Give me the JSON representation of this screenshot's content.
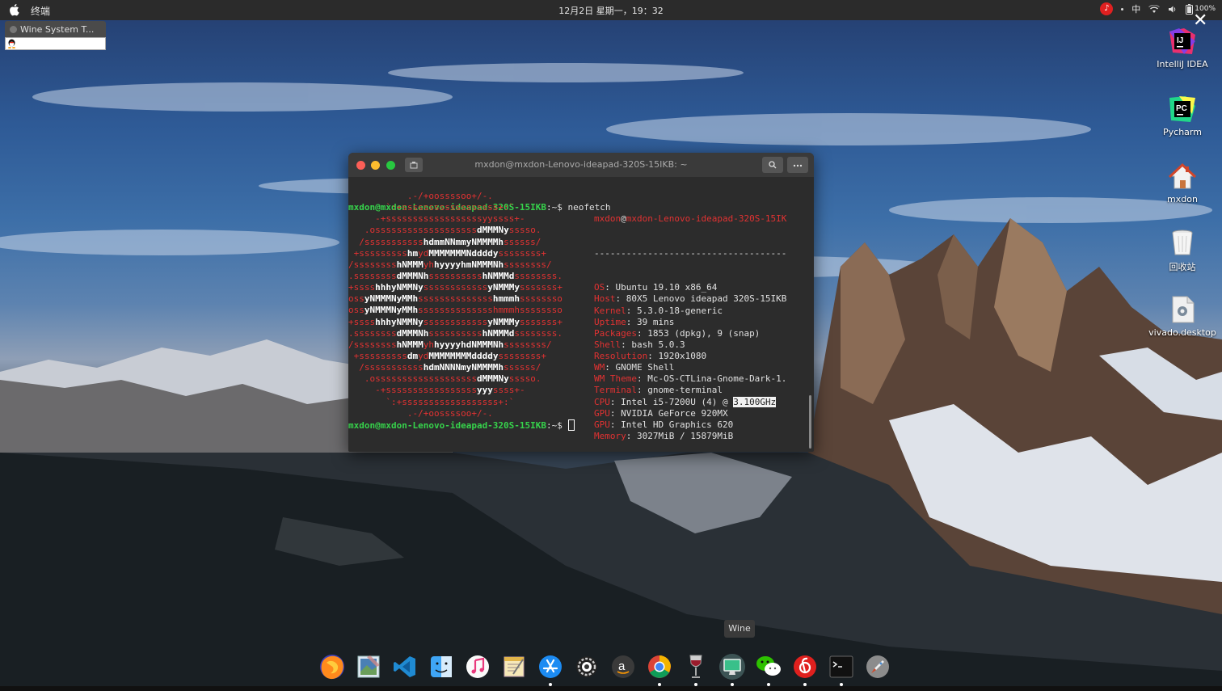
{
  "topbar": {
    "app_name": "终端",
    "clock": "12月2日 星期一，19：32",
    "input_method": "中",
    "battery": "100%",
    "netease_glyph": "♪"
  },
  "wine_window": {
    "title": "Wine System T..."
  },
  "desktop_icons": [
    {
      "label": "IntelliJ IDEA",
      "icon": "intellij-icon"
    },
    {
      "label": "Pycharm",
      "icon": "pycharm-icon"
    },
    {
      "label": "mxdon",
      "icon": "home-folder-icon"
    },
    {
      "label": "回收站",
      "icon": "trash-icon"
    },
    {
      "label": "vivado.desktop",
      "icon": "desktop-file-icon"
    }
  ],
  "terminal": {
    "title": "mxdon@mxdon-Lenovo-ideapad-320S-15IKB: ~",
    "prompt_user": "mxdon@mxdon-Lenovo-ideapad-320S-15IKB",
    "prompt_suffix": ":~$ ",
    "command": "neofetch",
    "header_user": "mxdon",
    "header_at": "@",
    "header_host": "mxdon-Lenovo-ideapad-320S-15IK",
    "separator": "------------------------------------",
    "info": [
      {
        "key": "OS",
        "value": "Ubuntu 19.10 x86_64"
      },
      {
        "key": "Host",
        "value": "80X5 Lenovo ideapad 320S-15IKB"
      },
      {
        "key": "Kernel",
        "value": "5.3.0-18-generic"
      },
      {
        "key": "Uptime",
        "value": "39 mins"
      },
      {
        "key": "Packages",
        "value": "1853 (dpkg), 9 (snap)"
      },
      {
        "key": "Shell",
        "value": "bash 5.0.3"
      },
      {
        "key": "Resolution",
        "value": "1920x1080"
      },
      {
        "key": "WM",
        "value": "GNOME Shell"
      },
      {
        "key": "WM Theme",
        "value": "Mc-OS-CTLina-Gnome-Dark-1."
      },
      {
        "key": "Terminal",
        "value": "gnome-terminal"
      },
      {
        "key": "CPU",
        "value": "Intel i5-7200U (4) @ ",
        "highlight": "3.100GHz"
      },
      {
        "key": "GPU",
        "value": "NVIDIA GeForce 920MX"
      },
      {
        "key": "GPU",
        "value": "Intel HD Graphics 620"
      },
      {
        "key": "Memory",
        "value": "3027MiB / 15879MiB"
      }
    ],
    "palette": [
      "#2c2c2c",
      "#cc0000",
      "#4e9a06",
      "#c4a000",
      "#3465a4",
      "#75507b",
      "#06989a",
      "#d3d7cf"
    ],
    "logo_lines": [
      [
        [
          "r",
          "           .-/+oossssoo+/-.           "
        ]
      ],
      [
        [
          "r",
          "       `:+ssssssssssssssssss+:`       "
        ]
      ],
      [
        [
          "r",
          "     -+ssssssssssssssssssyyssss+-     "
        ]
      ],
      [
        [
          "r",
          "   .osssssssssssssssssss"
        ],
        [
          "w",
          "dMMMNy"
        ],
        [
          "r",
          "sssso.   "
        ]
      ],
      [
        [
          "r",
          "  /sssssssssss"
        ],
        [
          "w",
          "hdmmNNmmyNMMMMh"
        ],
        [
          "r",
          "ssssss/  "
        ]
      ],
      [
        [
          "r",
          " +sssssssss"
        ],
        [
          "w",
          "hm"
        ],
        [
          "r",
          "yd"
        ],
        [
          "w",
          "MMMMMMMNddddy"
        ],
        [
          "r",
          "ssssssss+ "
        ]
      ],
      [
        [
          "r",
          "/ssssssss"
        ],
        [
          "w",
          "hNMMM"
        ],
        [
          "r",
          "yh"
        ],
        [
          "w",
          "hyyyyhmNMMMNh"
        ],
        [
          "r",
          "ssssssss/"
        ]
      ],
      [
        [
          "r",
          ".ssssssss"
        ],
        [
          "w",
          "dMMMNh"
        ],
        [
          "r",
          "ssssssssss"
        ],
        [
          "w",
          "hNMMMd"
        ],
        [
          "r",
          "ssssssss."
        ]
      ],
      [
        [
          "r",
          "+ssss"
        ],
        [
          "w",
          "hhhyNMMNy"
        ],
        [
          "r",
          "ssssssssssss"
        ],
        [
          "w",
          "yNMMMy"
        ],
        [
          "r",
          "sssssss+"
        ]
      ],
      [
        [
          "r",
          "oss"
        ],
        [
          "w",
          "yNMMMNyMMh"
        ],
        [
          "r",
          "ssssssssssssss"
        ],
        [
          "w",
          "hmmmh"
        ],
        [
          "r",
          "ssssssso"
        ]
      ],
      [
        [
          "r",
          "oss"
        ],
        [
          "w",
          "yNMMMNyMMh"
        ],
        [
          "r",
          "sssssssssssssshmmmhssssssso"
        ]
      ],
      [
        [
          "r",
          "+ssss"
        ],
        [
          "w",
          "hhhyNMMNy"
        ],
        [
          "r",
          "ssssssssssss"
        ],
        [
          "w",
          "yNMMMy"
        ],
        [
          "r",
          "sssssss+"
        ]
      ],
      [
        [
          "r",
          ".ssssssss"
        ],
        [
          "w",
          "dMMMNh"
        ],
        [
          "r",
          "ssssssssss"
        ],
        [
          "w",
          "hNMMMd"
        ],
        [
          "r",
          "ssssssss."
        ]
      ],
      [
        [
          "r",
          "/ssssssss"
        ],
        [
          "w",
          "hNMMM"
        ],
        [
          "r",
          "yh"
        ],
        [
          "w",
          "hyyyyhdNMMMNh"
        ],
        [
          "r",
          "ssssssss/"
        ]
      ],
      [
        [
          "r",
          " +sssssssss"
        ],
        [
          "w",
          "dm"
        ],
        [
          "r",
          "yd"
        ],
        [
          "w",
          "MMMMMMMMddddy"
        ],
        [
          "r",
          "ssssssss+ "
        ]
      ],
      [
        [
          "r",
          "  /sssssssssss"
        ],
        [
          "w",
          "hdmNNNNmyNMMMMh"
        ],
        [
          "r",
          "ssssss/  "
        ]
      ],
      [
        [
          "r",
          "   .osssssssssssssssssss"
        ],
        [
          "w",
          "dMMMNy"
        ],
        [
          "r",
          "sssso.   "
        ]
      ],
      [
        [
          "r",
          "     -+sssssssssssssssss"
        ],
        [
          "w",
          "yyy"
        ],
        [
          "r",
          "ssss+-     "
        ]
      ],
      [
        [
          "r",
          "       `:+ssssssssssssssssss+:`       "
        ]
      ],
      [
        [
          "r",
          "           .-/+oossssoo+/-.           "
        ]
      ]
    ]
  },
  "dock": {
    "tooltip": "Wine",
    "apps": [
      {
        "name": "Firefox",
        "icon": "firefox-icon",
        "running": false
      },
      {
        "name": "Image Viewer",
        "icon": "preview-icon",
        "running": false
      },
      {
        "name": "VS Code",
        "icon": "vscode-icon",
        "running": false
      },
      {
        "name": "Finder",
        "icon": "finder-icon",
        "running": false
      },
      {
        "name": "Music",
        "icon": "music-icon",
        "running": false
      },
      {
        "name": "Notes",
        "icon": "notes-icon",
        "running": false
      },
      {
        "name": "App Store",
        "icon": "appstore-icon",
        "running": true
      },
      {
        "name": "Settings",
        "icon": "gear-icon",
        "running": false
      },
      {
        "name": "Amazon",
        "icon": "amazon-icon",
        "running": false
      },
      {
        "name": "Chrome",
        "icon": "chrome-icon",
        "running": true
      },
      {
        "name": "Wine Glass",
        "icon": "wine-glass-icon",
        "running": true
      },
      {
        "name": "Wine",
        "icon": "wine-monitor-icon",
        "running": true
      },
      {
        "name": "WeChat",
        "icon": "wechat-icon",
        "running": true
      },
      {
        "name": "NetEase Music",
        "icon": "netease-icon",
        "running": true
      },
      {
        "name": "Terminal",
        "icon": "terminal-icon",
        "running": true
      },
      {
        "name": "Launchpad",
        "icon": "launchpad-icon",
        "running": false
      }
    ]
  }
}
